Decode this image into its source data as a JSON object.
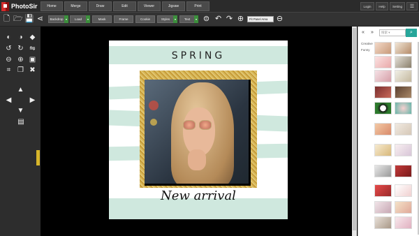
{
  "app": {
    "title": "PhotoSir"
  },
  "menu_tabs": [
    "Home",
    "Merge",
    "Draw",
    "Edit",
    "Viewer",
    "Jigsaw",
    "Print"
  ],
  "top_links": [
    "Login",
    "Help",
    "Setting"
  ],
  "toolbar": {
    "buttons": [
      "Backdrop",
      "Load",
      "Mask",
      "Frame",
      "Cookie",
      "Styles",
      "Text"
    ],
    "fit_select": "Fit Panel Area",
    "accent_color": "#3d8f3d"
  },
  "artwork": {
    "heading": "SPRING",
    "tagline": "New arrival",
    "stripe_color": "#cfe8de",
    "frame_color": "#d8b95a"
  },
  "right_panel": {
    "search_placeholder": "搜索 ▾",
    "categories": [
      "Creative",
      "Funny"
    ],
    "accent_color": "#26a69a"
  }
}
